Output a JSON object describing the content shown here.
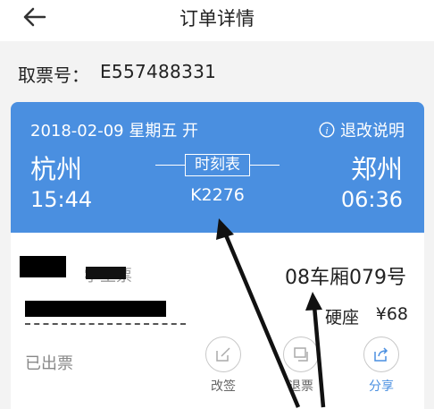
{
  "header": {
    "title": "订单详情",
    "back_icon": "arrow-left-icon"
  },
  "ticket": {
    "label": "取票号：",
    "number": "E557488331"
  },
  "trip": {
    "date": "2018-02-09 星期五 开",
    "rules_label": "退改说明",
    "from_city": "杭州",
    "to_city": "郑州",
    "departure_time": "15:44",
    "arrival_time": "06:36",
    "schedule_label": "时刻表",
    "train_number": "K2276"
  },
  "passenger": {
    "ticket_type": "学生票",
    "seat_number": "08车厢079号",
    "seat_type": "硬座",
    "price": "¥68",
    "status": "已出票"
  },
  "actions": [
    {
      "label": "改签",
      "icon": "edit-icon"
    },
    {
      "label": "退票",
      "icon": "refund-icon"
    },
    {
      "label": "分享",
      "icon": "share-icon"
    }
  ],
  "colors": {
    "accent": "#4a8fe0",
    "background": "#f3f3f3"
  }
}
